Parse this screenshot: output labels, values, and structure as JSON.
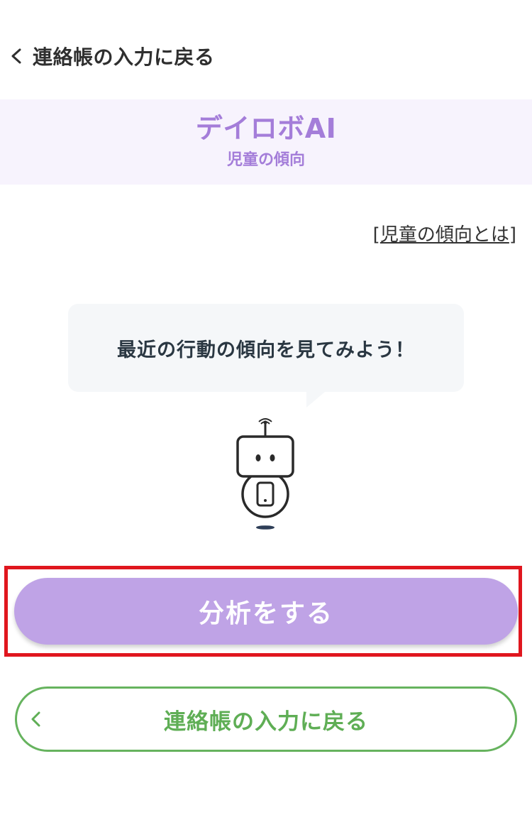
{
  "header": {
    "back_label": "連絡帳の入力に戻る"
  },
  "hero": {
    "title": "デイロボAI",
    "subtitle": "児童の傾向"
  },
  "help": {
    "bracket_open": "[",
    "link_text": "児童の傾向とは",
    "bracket_close": "]"
  },
  "bubble": {
    "message": "最近の行動の傾向を見てみよう！"
  },
  "actions": {
    "analyze_label": "分析をする",
    "return_label": "連絡帳の入力に戻る"
  },
  "colors": {
    "accent_purple": "#a47dd9",
    "button_purple": "#bfa3e6",
    "hero_bg": "#f7f3fd",
    "green": "#5fae55",
    "highlight_red": "#e0161e"
  },
  "icons": {
    "back": "chevron-left-icon",
    "robot": "robot-icon"
  }
}
